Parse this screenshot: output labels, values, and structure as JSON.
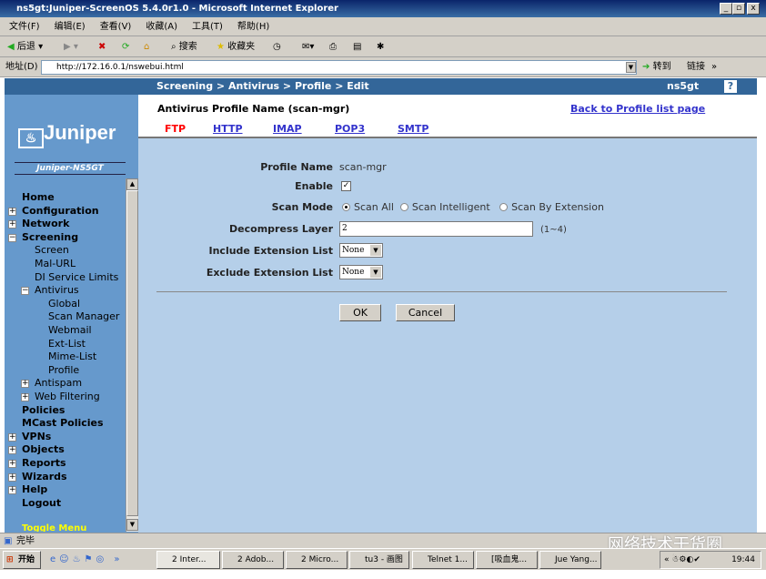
{
  "window": {
    "title": "ns5gt:Juniper-ScreenOS 5.4.0r1.0 - Microsoft Internet Explorer"
  },
  "menu": [
    "文件(F)",
    "编辑(E)",
    "查看(V)",
    "收藏(A)",
    "工具(T)",
    "帮助(H)"
  ],
  "toolbar": {
    "back": "后退",
    "search": "搜索",
    "favorites": "收藏夹"
  },
  "address": {
    "label": "地址(D)",
    "url": "http://172.16.0.1/nswebui.html",
    "go": "转到",
    "links": "链接"
  },
  "header": {
    "breadcrumb": "Screening > Antivirus > Profile > Edit",
    "device": "ns5gt",
    "help": "?"
  },
  "sidebar": {
    "logo": "Juniper",
    "device_name": "Juniper-NS5GT",
    "toggle": "Toggle Menu",
    "items": [
      {
        "label": "Home",
        "level": 0,
        "bold": true,
        "expander": ""
      },
      {
        "label": "Configuration",
        "level": 0,
        "bold": true,
        "expander": "+"
      },
      {
        "label": "Network",
        "level": 0,
        "bold": true,
        "expander": "+"
      },
      {
        "label": "Screening",
        "level": 0,
        "bold": true,
        "expander": "-"
      },
      {
        "label": "Screen",
        "level": 1,
        "bold": false,
        "expander": ""
      },
      {
        "label": "Mal-URL",
        "level": 1,
        "bold": false,
        "expander": ""
      },
      {
        "label": "DI Service Limits",
        "level": 1,
        "bold": false,
        "expander": ""
      },
      {
        "label": "Antivirus",
        "level": 1,
        "bold": false,
        "expander": "-"
      },
      {
        "label": "Global",
        "level": 2,
        "bold": false,
        "expander": ""
      },
      {
        "label": "Scan Manager",
        "level": 2,
        "bold": false,
        "expander": ""
      },
      {
        "label": "Webmail",
        "level": 2,
        "bold": false,
        "expander": ""
      },
      {
        "label": "Ext-List",
        "level": 2,
        "bold": false,
        "expander": ""
      },
      {
        "label": "Mime-List",
        "level": 2,
        "bold": false,
        "expander": ""
      },
      {
        "label": "Profile",
        "level": 2,
        "bold": false,
        "expander": ""
      },
      {
        "label": "Antispam",
        "level": 1,
        "bold": false,
        "expander": "+"
      },
      {
        "label": "Web Filtering",
        "level": 1,
        "bold": false,
        "expander": "+"
      },
      {
        "label": "Policies",
        "level": 0,
        "bold": true,
        "expander": ""
      },
      {
        "label": "MCast Policies",
        "level": 0,
        "bold": true,
        "expander": ""
      },
      {
        "label": "VPNs",
        "level": 0,
        "bold": true,
        "expander": "+"
      },
      {
        "label": "Objects",
        "level": 0,
        "bold": true,
        "expander": "+"
      },
      {
        "label": "Reports",
        "level": 0,
        "bold": true,
        "expander": "+"
      },
      {
        "label": "Wizards",
        "level": 0,
        "bold": true,
        "expander": "+"
      },
      {
        "label": "Help",
        "level": 0,
        "bold": true,
        "expander": "+"
      },
      {
        "label": "Logout",
        "level": 0,
        "bold": true,
        "expander": ""
      }
    ]
  },
  "page": {
    "title": "Antivirus Profile Name (scan-mgr)",
    "back_link": "Back to Profile list page",
    "tabs": [
      {
        "label": "FTP",
        "active": true
      },
      {
        "label": "HTTP"
      },
      {
        "label": "IMAP"
      },
      {
        "label": "POP3"
      },
      {
        "label": "SMTP"
      }
    ]
  },
  "form": {
    "profile_name_label": "Profile Name",
    "profile_name": "scan-mgr",
    "enable_label": "Enable",
    "enable": true,
    "scan_mode_label": "Scan Mode",
    "scan_modes": [
      "Scan All",
      "Scan Intelligent",
      "Scan By Extension"
    ],
    "scan_mode_selected": "Scan All",
    "decompress_label": "Decompress Layer",
    "decompress_value": "2",
    "decompress_range": "(1~4)",
    "include_label": "Include Extension List",
    "include_value": "None",
    "exclude_label": "Exclude Extension List",
    "exclude_value": "None",
    "ok": "OK",
    "cancel": "Cancel"
  },
  "statusbar": {
    "text": "完毕"
  },
  "taskbar": {
    "start": "开始",
    "tasks": [
      "2 Inter...",
      "2 Adob...",
      "2 Micro...",
      "tu3 - 画图",
      "Telnet 1...",
      "[吸血鬼...",
      "Jue Yang..."
    ],
    "clock": "19:44"
  },
  "watermark": "网络技术干货圈",
  "colors": {
    "header": "#336699",
    "sidebar": "#6699cc",
    "form_bg": "#b5cfe9",
    "active_tab": "#ff0000",
    "link": "#3333cc"
  }
}
